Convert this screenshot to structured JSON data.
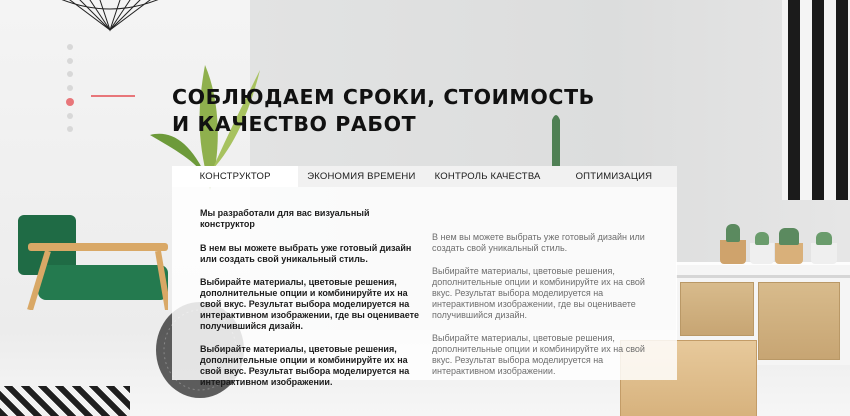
{
  "slider": {
    "dots": [
      {
        "active": false
      },
      {
        "active": false
      },
      {
        "active": false
      },
      {
        "active": false
      },
      {
        "active": true
      },
      {
        "active": false
      },
      {
        "active": false
      }
    ],
    "accent_color": "#e8767a"
  },
  "hero": {
    "title_line1": "СОБЛЮДАЕМ СРОКИ, СТОИМОСТЬ",
    "title_line2": "И КАЧЕСТВО РАБОТ"
  },
  "tabs": [
    {
      "label": "КОНСТРУКТОР",
      "active": true
    },
    {
      "label": "ЭКОНОМИЯ ВРЕМЕНИ",
      "active": false
    },
    {
      "label": "КОНТРОЛЬ КАЧЕСТВА",
      "active": false
    },
    {
      "label": "ОПТИМИЗАЦИЯ",
      "active": false
    }
  ],
  "content": {
    "left": {
      "intro": "Мы разработали для вас визуальный конструктор",
      "paragraphs": [
        "В нем вы можете выбрать уже готовый дизайн или создать свой уникальный стиль.",
        "Выбирайте материалы, цветовые решения, дополнительные опции и комбинируйте их на свой вкус. Результат выбора моделируется на интерактивном изображении, где вы оцениваете получившийся дизайн.",
        "Выбирайте материалы, цветовые решения, дополнительные опции и комбинируйте их на свой вкус. Результат выбора моделируется на интерактивном изображении."
      ]
    },
    "right": {
      "paragraphs": [
        "В нем вы можете выбрать уже готовый дизайн или создать свой уникальный стиль.",
        "Выбирайте материалы, цветовые решения, дополнительные опции и комбинируйте их на свой вкус. Результат выбора моделируется на интерактивном изображении, где вы оцениваете получившийся дизайн.",
        "Выбирайте материалы, цветовые решения, дополнительные опции и комбинируйте их на свой вкус. Результат выбора моделируется на интерактивном изображении."
      ]
    }
  }
}
